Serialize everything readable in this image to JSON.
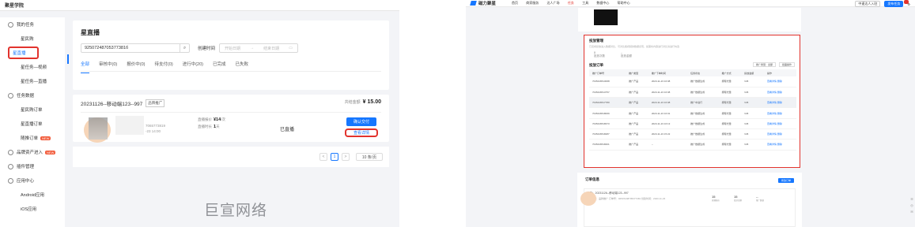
{
  "left": {
    "app_title": "聚星学院",
    "sidebar": {
      "items": [
        {
          "label": "我的任务",
          "type": "group",
          "icon": "task-icon"
        },
        {
          "label": "星民购",
          "type": "sub"
        },
        {
          "label": "星直播",
          "type": "sub",
          "active": true
        },
        {
          "label": "星任务—视频",
          "type": "sub"
        },
        {
          "label": "星任务—直播",
          "type": "sub"
        },
        {
          "label": "任务数据",
          "type": "group",
          "icon": "data-icon"
        },
        {
          "label": "星民购订单",
          "type": "sub"
        },
        {
          "label": "星直播订单",
          "type": "sub"
        },
        {
          "label": "随推订单",
          "type": "sub",
          "badge": "NEW"
        },
        {
          "label": "品牌资产进入",
          "type": "group",
          "icon": "brand-icon",
          "badge": "NEW"
        },
        {
          "label": "插件管理",
          "type": "group",
          "icon": "plugin-icon"
        },
        {
          "label": "应用中心",
          "type": "group",
          "icon": "app-icon"
        },
        {
          "label": "Android应用",
          "type": "sub"
        },
        {
          "label": "iOS应用",
          "type": "sub"
        }
      ]
    },
    "main": {
      "title": "星直播",
      "search_value": "92507248705377381б",
      "time_label": "创建时间",
      "date_start_placeholder": "开始日期",
      "date_end_placeholder": "结束日期",
      "tabs": [
        "全部",
        "审核中(0)",
        "报价中(0)",
        "待支付(0)",
        "进行中(20)",
        "已完成",
        "已失败"
      ],
      "order": {
        "title": "20231126--移动端123--997",
        "tag": "品牌推广",
        "amount_label": "共结金额",
        "amount": "¥ 15.00",
        "mini_line1": "7065773819",
        "mini_line2": "-23 14:00",
        "price_label1": "直播报价",
        "price_value1": "¥14",
        "price_unit1": "/次",
        "price_label2": "直播时长",
        "price_value2": "1",
        "price_unit2": "天",
        "status": "已直播",
        "confirm_button": "确认交付",
        "detail_button": "查看详情"
      },
      "pagination": {
        "current": "1",
        "prev": "<",
        "next": ">",
        "page_size": "10 条/页"
      }
    },
    "watermark": "巨宣网络"
  },
  "right": {
    "logo": "磁力聚星",
    "nav": [
      "首页",
      "商家服务",
      "达人广场",
      "任务",
      "工具",
      "数据中心",
      "帮助中心"
    ],
    "top_right": [
      "中速达人入驻",
      "发布任务",
      "⚙"
    ],
    "main_card": {
      "title": "投放管理",
      "desc": "已完成投放进入数据对比，可对比各视频的数据表现，如需将内容进行对比请进行勾选",
      "kv": [
        {
          "k": "投放次数",
          "v": "8"
        },
        {
          "k": "投放金额",
          "v": "--"
        }
      ],
      "subtitle": "投放订单",
      "controls": [
        "推广类型：全部",
        "批量操作"
      ],
      "columns": [
        "推广订单号",
        "推广类型",
        "推广下单时间",
        "任务状态",
        "推广方式",
        "投放金额",
        "操作"
      ],
      "rows": [
        [
          "7045446513068",
          "推广产品",
          "2023-11-23 16:08",
          "推广数据生成",
          "按曝光量",
          "¥45",
          "查看详情  删除"
        ],
        [
          "7045446513757",
          "推广产品",
          "2023-11-23 16:08",
          "推广数据生成",
          "按曝光量",
          "¥45",
          "查看详情  删除"
        ],
        [
          "7045446517780",
          "推广产品",
          "2023-11-23 16:08",
          "推广中进行",
          "按曝光量",
          "¥45",
          "查看详情  删除"
        ],
        [
          "7045446518069",
          "推广产品",
          "2023-11-23 16:01",
          "推广数据生成",
          "按曝光量",
          "¥45",
          "查看详情  删除"
        ],
        [
          "7045446518373",
          "推广产品",
          "2023-11-23 16:13",
          "推广数据生成",
          "按曝光量",
          "¥45",
          "查看详情  删除"
        ],
        [
          "7045446518287",
          "推广产品",
          "2023-11-23 15:22",
          "推广数据生成",
          "按曝光量",
          "¥45",
          "查看详情  删除"
        ],
        [
          "7045446518401",
          "推广产品",
          "--",
          "推广数据生成",
          "按曝光量",
          "¥45",
          "查看详情  删除"
        ]
      ]
    },
    "bottom_card": {
      "title": "订单信息",
      "button": "修改订单",
      "line1": "任务：20231126--移动端123--997",
      "line2": "推广类型：品牌推广    订单号：92507248705377381    创建时间：2023-11-23",
      "nums": [
        {
          "v": "15",
          "k": "直播报价"
        },
        {
          "v": "15",
          "k": "投放金额"
        },
        {
          "v": "--",
          "k": "推广数据"
        }
      ]
    },
    "side_icons": [
      "☰",
      "◎",
      "✉"
    ]
  }
}
